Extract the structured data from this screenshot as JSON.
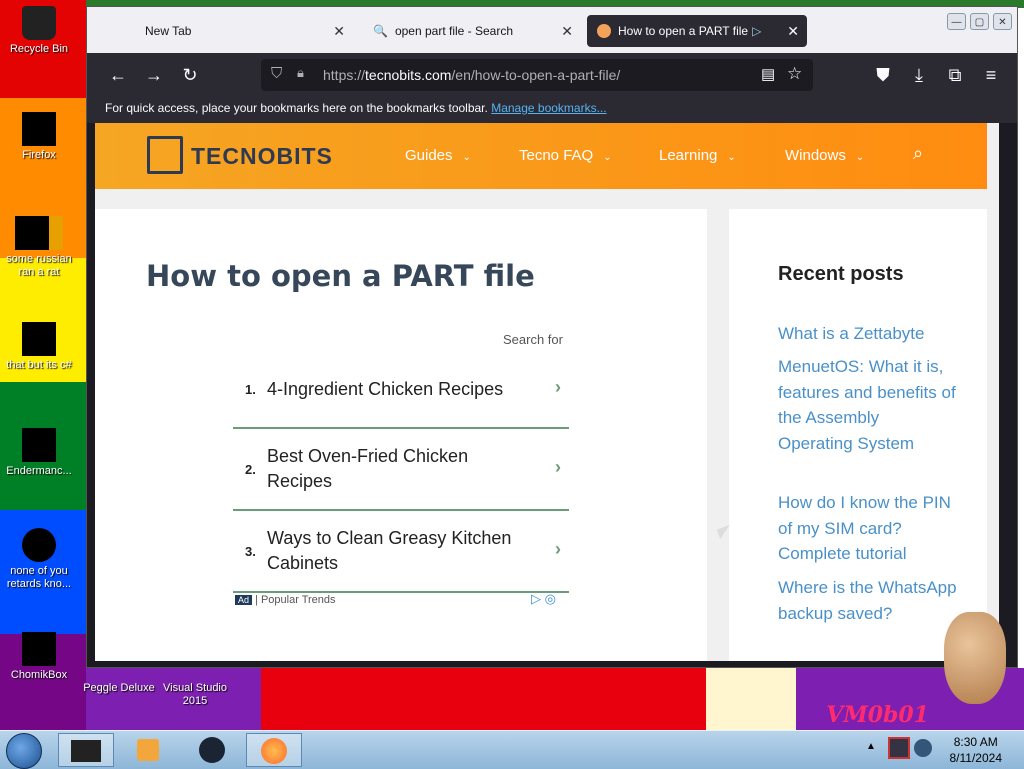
{
  "desktop": {
    "icons": [
      {
        "label": "Recycle Bin"
      },
      {
        "label": "Firefox"
      },
      {
        "label": "some russian ran a rat"
      },
      {
        "label": "that but its c#"
      },
      {
        "label": "Endermanc..."
      },
      {
        "label": "none of you retards kno..."
      },
      {
        "label": "ChomikBox"
      }
    ],
    "bottom_icons": [
      {
        "label": "Peggle Deluxe"
      },
      {
        "label": "Visual Studio 2015"
      }
    ],
    "wallpaper_text": "VM0b01"
  },
  "browser": {
    "tabs": [
      {
        "label": "New Tab"
      },
      {
        "label": "open part file - Search"
      },
      {
        "label": "How to open a PART file"
      }
    ],
    "url_prefix": "https://",
    "url_host": "tecnobits.com",
    "url_path": "/en/how-to-open-a-part-file/",
    "bookmarks_text": "For quick access, place your bookmarks here on the bookmarks toolbar.",
    "bookmarks_link": "Manage bookmarks..."
  },
  "site": {
    "logo": "TECNOBITS",
    "menu": [
      {
        "label": "Guides"
      },
      {
        "label": "Tecno FAQ"
      },
      {
        "label": "Learning"
      },
      {
        "label": "Windows"
      }
    ]
  },
  "article": {
    "title": "How to open a PART file",
    "search_for": "Search for",
    "ads": [
      {
        "num": "1.",
        "text": "4-Ingredient Chicken Recipes"
      },
      {
        "num": "2.",
        "text": "Best Oven-Fried Chicken Recipes"
      },
      {
        "num": "3.",
        "text": "Ways to Clean Greasy Kitchen Cabinets"
      }
    ],
    "ad_badge": "Ad",
    "ad_source": "Popular Trends"
  },
  "sidebar": {
    "heading": "Recent posts",
    "posts": [
      {
        "title": "What is a Zettabyte"
      },
      {
        "title": "MenuetOS: What it is, features and benefits of the Assembly Operating System"
      },
      {
        "title": "How do I know the PIN of my SIM card? Complete tutorial"
      },
      {
        "title": "Where is the WhatsApp backup saved?"
      }
    ]
  },
  "taskbar": {
    "time": "8:30 AM",
    "date": "8/11/2024"
  },
  "colors": {
    "accent_orange": "#ff8c10",
    "link_blue": "#4a90c8",
    "ad_green": "#6a9c7a"
  }
}
